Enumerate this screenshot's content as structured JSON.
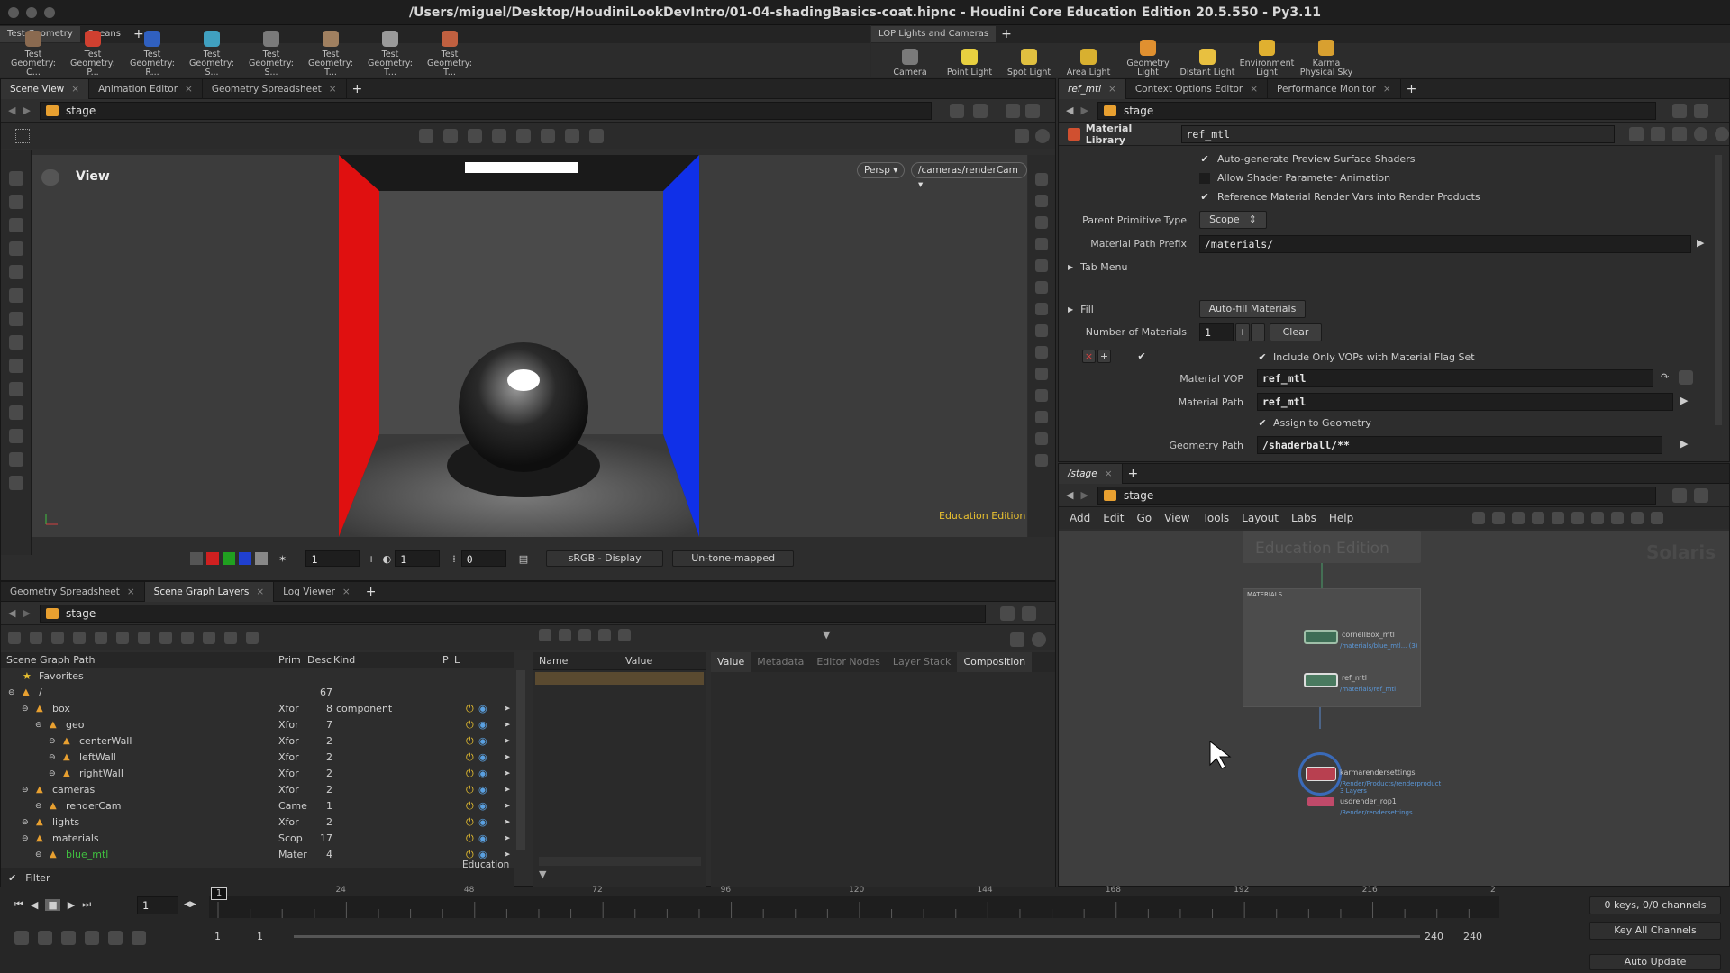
{
  "window": {
    "title": "/Users/miguel/Desktop/HoudiniLookDevIntro/01-04-shadingBasics-coat.hipnc - Houdini Core Education Edition 20.5.550 - Py3.11"
  },
  "left_shelf": {
    "tabs": [
      "Test Geometry",
      "Oceans"
    ],
    "tools": [
      "Test Geometry: C...",
      "Test Geometry: P...",
      "Test Geometry: R...",
      "Test Geometry: S...",
      "Test Geometry: S...",
      "Test Geometry: T...",
      "Test Geometry: T...",
      "Test Geometry: T..."
    ],
    "tool_colors": [
      "#8a6a50",
      "#d04030",
      "#3060c0",
      "#40a0c0",
      "#7a7a7a",
      "#a08060",
      "#9a9a9a",
      "#c06040"
    ]
  },
  "right_shelf": {
    "tabs": [
      "LOP Lights and Cameras"
    ],
    "tools": [
      "Camera",
      "Point Light",
      "Spot Light",
      "Area Light",
      "Geometry Light",
      "Distant Light",
      "Environment Light",
      "Karma Physical Sky"
    ],
    "tool_colors": [
      "#7a7a7a",
      "#e8d040",
      "#e0c040",
      "#d8b030",
      "#e09030",
      "#e8c040",
      "#e0b030",
      "#d8a030"
    ]
  },
  "viewer": {
    "tabs": [
      "Scene View",
      "Animation Editor",
      "Geometry Spreadsheet"
    ],
    "path": "stage",
    "view_label": "View",
    "persp": "Persp ▾",
    "camera": "/cameras/renderCam ▾",
    "watermark": "Education Edition",
    "bottom": {
      "frame1": "1",
      "frame2": "1",
      "frame3": "0",
      "colorspace": "sRGB - Display",
      "tonemap": "Un-tone-mapped"
    }
  },
  "params": {
    "tabs": [
      "ref_mtl",
      "Context Options Editor",
      "Performance Monitor"
    ],
    "path": "stage",
    "node_type": "Material Library",
    "node_name": "ref_mtl",
    "check1": "Auto-generate Preview Surface Shaders",
    "check2": "Allow Shader Parameter Animation",
    "check3": "Reference Material Render Vars into Render Products",
    "parent_prim_label": "Parent Primitive Type",
    "parent_prim_value": "Scope",
    "mat_prefix_label": "Material Path Prefix",
    "mat_prefix_value": "/materials/",
    "tab_menu": "Tab Menu",
    "fill": "Fill",
    "autofill": "Auto-fill Materials",
    "num_label": "Number of Materials",
    "num_value": "1",
    "clear": "Clear",
    "include_vops": "Include Only VOPs with Material Flag Set",
    "vop_label": "Material VOP",
    "vop_value": "ref_mtl",
    "mpath_label": "Material Path",
    "mpath_value": "ref_mtl",
    "assign": "Assign to Geometry",
    "gpath_label": "Geometry Path",
    "gpath_value": "/shaderball/**"
  },
  "network": {
    "tabs": [
      "/stage"
    ],
    "path": "stage",
    "menu": [
      "Add",
      "Edit",
      "Go",
      "View",
      "Tools",
      "Layout",
      "Labs",
      "Help"
    ],
    "watermark": "Education Edition",
    "solaris": "Solaris",
    "box_title": "MATERIALS",
    "nodes": [
      {
        "name": "cornellBox_mtl",
        "sub": "/materials/blue_mtl... (3)"
      },
      {
        "name": "ref_mtl",
        "sub": "/materials/ref_mtl"
      },
      {
        "name": "karmarendersettings",
        "sub": "/Render/Products/renderproduct",
        "sub2": "3 Layers"
      },
      {
        "name": "usdrender_rop1",
        "sub": "/Render/rendersettings"
      }
    ]
  },
  "scene_graph": {
    "tabs": [
      "Geometry Spreadsheet",
      "Scene Graph Layers",
      "Log Viewer"
    ],
    "path": "stage",
    "headers": {
      "path": "Scene Graph Path",
      "prim": "Prim",
      "desc": "Desc",
      "kind": "Kind",
      "p": "P",
      "l": "L"
    },
    "favorites": "Favorites",
    "rows": [
      {
        "name": "/",
        "type": "",
        "desc": "67",
        "kind": "",
        "indent": 0
      },
      {
        "name": "box",
        "type": "Xfor",
        "desc": "8",
        "kind": "component",
        "indent": 1
      },
      {
        "name": "geo",
        "type": "Xfor",
        "desc": "7",
        "kind": "",
        "indent": 2
      },
      {
        "name": "centerWall",
        "type": "Xfor",
        "desc": "2",
        "kind": "",
        "indent": 3
      },
      {
        "name": "leftWall",
        "type": "Xfor",
        "desc": "2",
        "kind": "",
        "indent": 3
      },
      {
        "name": "rightWall",
        "type": "Xfor",
        "desc": "2",
        "kind": "",
        "indent": 3
      },
      {
        "name": "cameras",
        "type": "Xfor",
        "desc": "2",
        "kind": "",
        "indent": 1
      },
      {
        "name": "renderCam",
        "type": "Came",
        "desc": "1",
        "kind": "",
        "indent": 2
      },
      {
        "name": "lights",
        "type": "Xfor",
        "desc": "2",
        "kind": "",
        "indent": 1
      },
      {
        "name": "materials",
        "type": "Scop",
        "desc": "17",
        "kind": "",
        "indent": 1
      },
      {
        "name": "blue_mtl",
        "type": "Mater",
        "desc": "4",
        "kind": "",
        "indent": 2
      }
    ],
    "filter": "Filter",
    "edu": "Education",
    "attr_headers": {
      "name": "Name",
      "value": "Value"
    },
    "detail_tabs": [
      "Value",
      "Metadata",
      "Editor Nodes",
      "Layer Stack",
      "Composition"
    ]
  },
  "timeline": {
    "frame": "1",
    "ticks": [
      "1",
      "24",
      "48",
      "72",
      "96",
      "120",
      "144",
      "168",
      "192",
      "216",
      "2"
    ],
    "start": "1",
    "start2": "1",
    "end": "240",
    "end2": "240",
    "keys": "0 keys, 0/0 channels",
    "key_all": "Key All Channels",
    "auto_update": "Auto Update"
  }
}
